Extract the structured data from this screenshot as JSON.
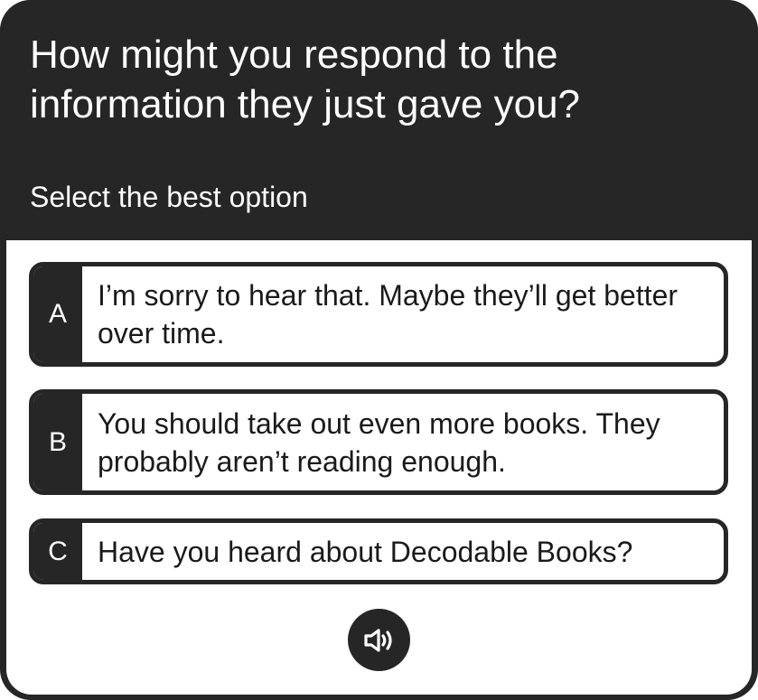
{
  "question": {
    "title": "How might you respond to the information they just gave you?",
    "instruction": "Select the best option"
  },
  "options": [
    {
      "letter": "A",
      "text": "I’m sorry to hear that. Maybe they’ll get better over time."
    },
    {
      "letter": "B",
      "text": "You should take out even more books. They probably aren’t reading enough."
    },
    {
      "letter": "C",
      "text": "Have you heard about Decodable Books?"
    }
  ],
  "audio": {
    "icon": "speaker-icon"
  },
  "colors": {
    "dark": "#262626",
    "background": "#ffffff",
    "text": "#1a1a1a"
  }
}
